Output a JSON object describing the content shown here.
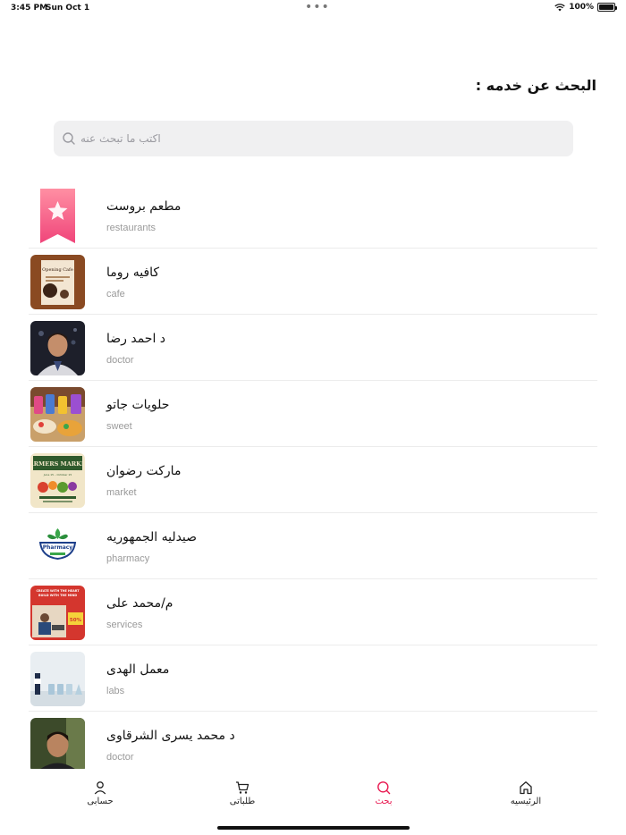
{
  "status_bar": {
    "time": "3:45 PM",
    "date": "Sun Oct 1",
    "battery": "100%",
    "battery_level": 1.0
  },
  "page": {
    "title": "البحث عن خدمه :"
  },
  "search": {
    "placeholder": "اكتب ما تبحث عنه"
  },
  "services": [
    {
      "name": "مطعم بروست",
      "category": "restaurants",
      "icon": "bookmark-star-icon"
    },
    {
      "name": "كافيه روما",
      "category": "cafe",
      "icon": "cafe-poster-thumbnail"
    },
    {
      "name": "د احمد رضا",
      "category": "doctor",
      "icon": "doctor-photo-thumbnail"
    },
    {
      "name": "حلويات جاتو",
      "category": "sweet",
      "icon": "sweets-photo-thumbnail"
    },
    {
      "name": "ماركت رضوان",
      "category": "market",
      "icon": "farmers-market-thumbnail"
    },
    {
      "name": "صيدليه الجمهوريه",
      "category": "pharmacy",
      "icon": "pharmacy-logo-thumbnail"
    },
    {
      "name": "م/محمد على",
      "category": "services",
      "icon": "services-poster-thumbnail"
    },
    {
      "name": "معمل الهدى",
      "category": "labs",
      "icon": "lab-photo-thumbnail"
    },
    {
      "name": "د محمد يسرى الشرقاوى",
      "category": "doctor",
      "icon": "doctor-photo-thumbnail"
    }
  ],
  "thumbs": {
    "cafe_poster_title": "Opening Cafe",
    "market_title": "FARMERS MARKET",
    "market_subtitle": "June 15 – October 15",
    "pharmacy_logo_text": "Pharmacy",
    "services_poster_line1": "CREATE WITH THE HEART",
    "services_poster_line2": "BUILD WITH THE MIND",
    "services_poster_badge": "50%"
  },
  "tabs": [
    {
      "label": "حسابى",
      "icon": "user-icon",
      "active": false
    },
    {
      "label": "طلباتى",
      "icon": "cart-icon",
      "active": false
    },
    {
      "label": "بحث",
      "icon": "search-icon",
      "active": true
    },
    {
      "label": "الرئيسيه",
      "icon": "home-icon",
      "active": false
    }
  ],
  "colors": {
    "accent": "#e8174f",
    "search_bg": "#f0f0f1",
    "bookmark_top": "#ff8fa3",
    "bookmark_bottom": "#f0457a"
  }
}
